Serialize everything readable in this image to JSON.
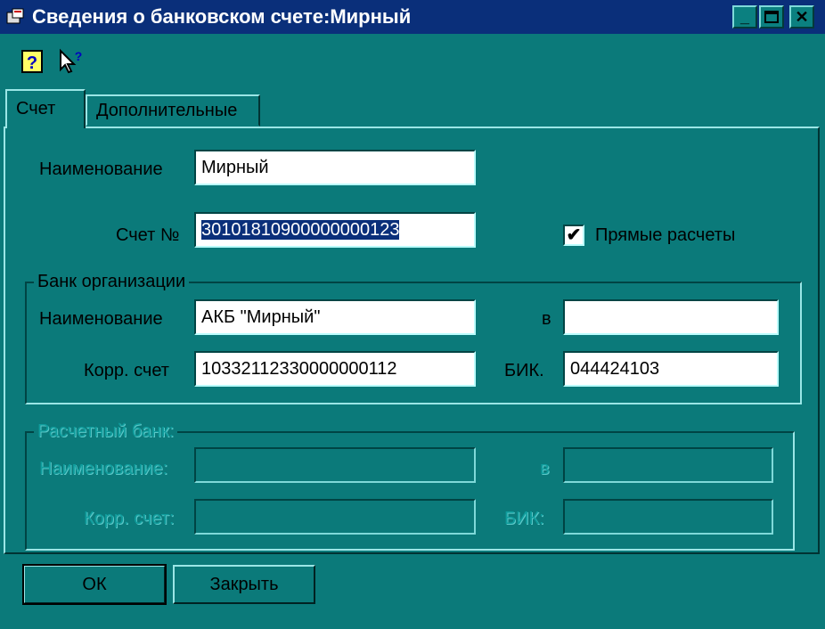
{
  "window": {
    "title": "Сведения о банковском счете:Мирный",
    "controls": [
      "minimize-icon",
      "maximize-icon",
      "close-icon"
    ]
  },
  "toolbar": {
    "icons": [
      "help-icon",
      "context-help-icon"
    ]
  },
  "tabs": [
    {
      "label": "Счет",
      "active": true
    },
    {
      "label": "Дополнительные",
      "active": false
    }
  ],
  "account": {
    "name_label": "Наименование",
    "name_value": "Мирный",
    "number_label": "Счет №",
    "number_value": "30101810900000000123",
    "direct_label": "Прямые расчеты",
    "direct_checked": true
  },
  "org_bank": {
    "title": "Банк организации",
    "name_label": "Наименование",
    "name_value": "АКБ \"Мирный\"",
    "city_label": "в",
    "city_value": "",
    "corr_label": "Корр. счет",
    "corr_value": "10332112330000000112",
    "bik_label": "БИК.",
    "bik_value": "044424103"
  },
  "settle_bank": {
    "title": "Расчетный банк:",
    "name_label": "Наименование:",
    "name_value": "",
    "city_label": "в",
    "city_value": "",
    "corr_label": "Корр. счет:",
    "corr_value": "",
    "bik_label": "БИК:",
    "bik_value": ""
  },
  "buttons": {
    "ok": "ОК",
    "close": "Закрыть"
  }
}
